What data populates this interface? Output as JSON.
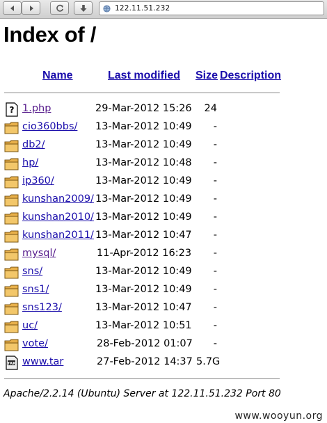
{
  "browser": {
    "url": "122.11.51.232"
  },
  "page": {
    "title": "Index of /",
    "columns": {
      "name": "Name",
      "last_modified": "Last modified",
      "size": "Size",
      "description": "Description"
    },
    "rows": [
      {
        "icon": "unknown-file-icon",
        "name": "1.php",
        "date": "29-Mar-2012 15:26",
        "size": "24",
        "visited": true
      },
      {
        "icon": "folder-icon",
        "name": "cio360bbs/",
        "date": "13-Mar-2012 10:49",
        "size": "-",
        "visited": false
      },
      {
        "icon": "folder-icon",
        "name": "db2/",
        "date": "13-Mar-2012 10:49",
        "size": "-",
        "visited": false
      },
      {
        "icon": "folder-icon",
        "name": "hp/",
        "date": "13-Mar-2012 10:48",
        "size": "-",
        "visited": false
      },
      {
        "icon": "folder-icon",
        "name": "ip360/",
        "date": "13-Mar-2012 10:49",
        "size": "-",
        "visited": false
      },
      {
        "icon": "folder-icon",
        "name": "kunshan2009/",
        "date": "13-Mar-2012 10:49",
        "size": "-",
        "visited": false
      },
      {
        "icon": "folder-icon",
        "name": "kunshan2010/",
        "date": "13-Mar-2012 10:49",
        "size": "-",
        "visited": false
      },
      {
        "icon": "folder-icon",
        "name": "kunshan2011/",
        "date": "13-Mar-2012 10:47",
        "size": "-",
        "visited": false
      },
      {
        "icon": "folder-icon",
        "name": "mysql/",
        "date": "11-Apr-2012 16:23",
        "size": "-",
        "visited": true
      },
      {
        "icon": "folder-icon",
        "name": "sns/",
        "date": "13-Mar-2012 10:49",
        "size": "-",
        "visited": false
      },
      {
        "icon": "folder-icon",
        "name": "sns1/",
        "date": "13-Mar-2012 10:49",
        "size": "-",
        "visited": false
      },
      {
        "icon": "folder-icon",
        "name": "sns123/",
        "date": "13-Mar-2012 10:47",
        "size": "-",
        "visited": false
      },
      {
        "icon": "folder-icon",
        "name": "uc/",
        "date": "13-Mar-2012 10:51",
        "size": "-",
        "visited": false
      },
      {
        "icon": "folder-icon",
        "name": "vote/",
        "date": "28-Feb-2012 01:07",
        "size": "-",
        "visited": false
      },
      {
        "icon": "tar-archive-icon",
        "name": "www.tar",
        "date": "27-Feb-2012 14:37",
        "size": "5.7G",
        "visited": false
      }
    ],
    "footer": "Apache/2.2.14 (Ubuntu) Server at 122.11.51.232 Port 80"
  },
  "watermark": "www.wooyun.org",
  "colors": {
    "link": "#1a0dab",
    "visited_link": "#551a8b",
    "folder": "#e8b04a"
  }
}
